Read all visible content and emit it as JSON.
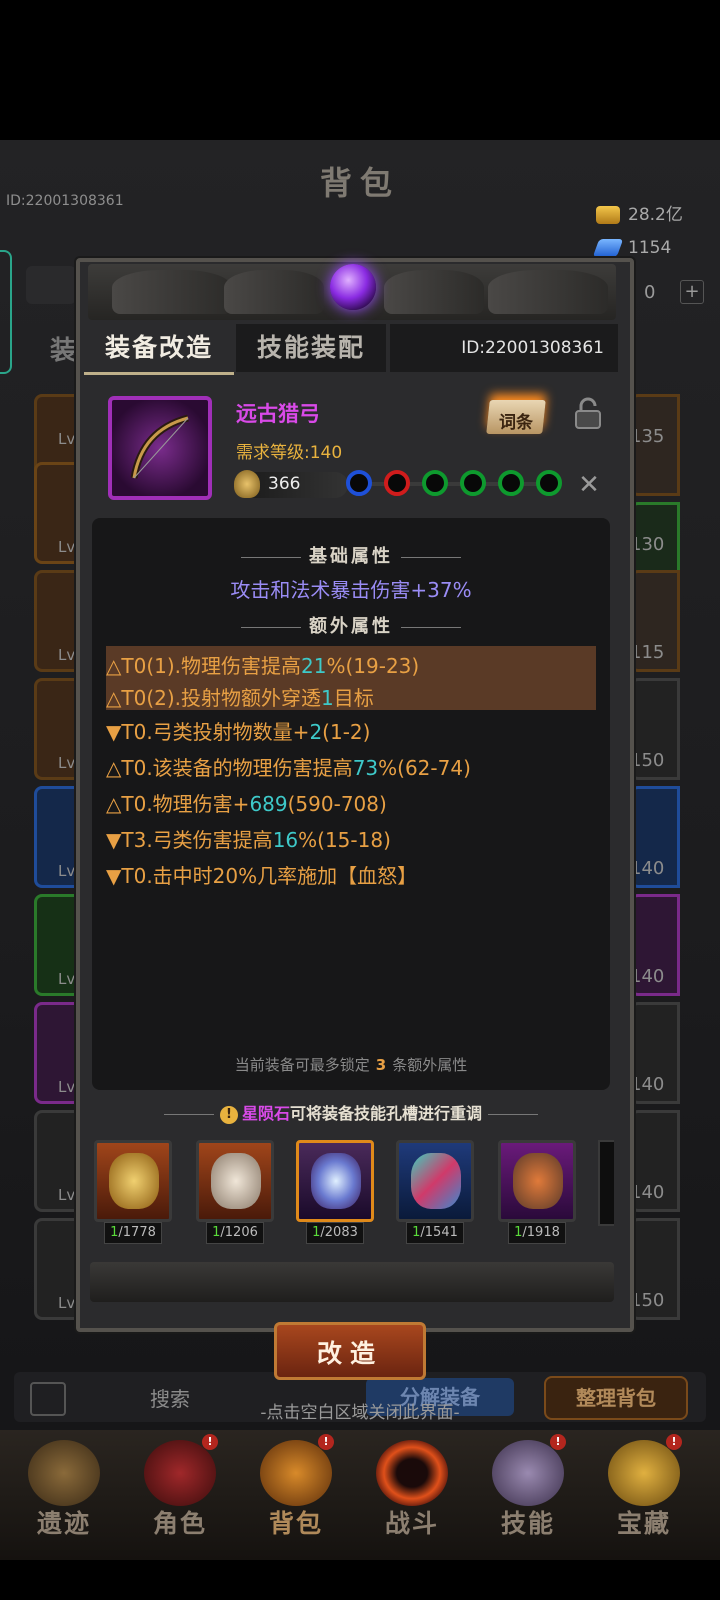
{
  "background": {
    "bag_title": "背包",
    "player_id": "ID:22001308361",
    "gold": "28.2亿",
    "gems": "1154",
    "third_resource": "0",
    "plus_label": "+",
    "left_tab_fragment": "装",
    "slot_lv_label": "Lv",
    "slot_levels": [
      "135",
      "130",
      "115",
      "150",
      "140",
      "140",
      "140",
      "140",
      "150"
    ],
    "search_label": "搜索",
    "decompose_label": "分解装备",
    "sort_label": "整理背包",
    "close_hint": "-点击空白区域关闭此界面-"
  },
  "nav": {
    "items": [
      {
        "label": "遗迹",
        "badge": ""
      },
      {
        "label": "角色",
        "badge": "!"
      },
      {
        "label": "背包",
        "badge": "!"
      },
      {
        "label": "战斗",
        "badge": ""
      },
      {
        "label": "技能",
        "badge": "!"
      },
      {
        "label": "宝藏",
        "badge": "!"
      }
    ]
  },
  "modal": {
    "tabs": {
      "reforge": "装备改造",
      "skill": "技能装配"
    },
    "id": "ID:22001308361",
    "item": {
      "name": "远古猎弓",
      "requirement": "需求等级:140",
      "power": "366",
      "affix_button": "词条"
    },
    "sockets": [
      "blue",
      "red",
      "green",
      "green",
      "green",
      "green"
    ],
    "colors": {
      "blue": "#1e50d8",
      "red": "#d01c1c",
      "green": "#0e9a2e",
      "accent": "#d94ae8",
      "affix": "#e8a044",
      "value": "#3ec9c9"
    },
    "base_title": "基础属性",
    "base_attr": "攻击和法术暴击伤害+37%",
    "extra_title": "额外属性",
    "affixes": [
      {
        "pre": "△T0(1).物理伤害提高",
        "val": "21",
        "post": "%(19-23)",
        "highlight": true
      },
      {
        "pre": "△T0(2).投射物额外穿透",
        "val": "1",
        "post": "目标",
        "highlight": true
      },
      {
        "pre": "▼T0.弓类投射物数量+",
        "val": "2",
        "post": "(1-2)",
        "highlight": false
      },
      {
        "pre": "△T0.该装备的物理伤害提高",
        "val": "73",
        "post": "%(62-74)",
        "highlight": false
      },
      {
        "pre": "△T0.物理伤害+",
        "val": "689",
        "post": "(590-708)",
        "highlight": false
      },
      {
        "pre": "▼T3.弓类伤害提高",
        "val": "16",
        "post": "%(15-18)",
        "highlight": false
      },
      {
        "pre": "▼T0.击中时20%几率施加【血怒】",
        "val": "",
        "post": "",
        "highlight": false
      }
    ],
    "lock_note": {
      "pre": "当前装备可最多锁定",
      "num": "3",
      "post": "条额外属性"
    },
    "stone_hint": {
      "stone": "星陨石",
      "rest": "可将装备技能孔槽进行重调"
    },
    "materials": [
      {
        "name": "golden-orb",
        "have": "1",
        "need": "/1778"
      },
      {
        "name": "twin-masks",
        "have": "1",
        "need": "/1206"
      },
      {
        "name": "star-crystal",
        "have": "1",
        "need": "/2083"
      },
      {
        "name": "prism-ore",
        "have": "1",
        "need": "/1541"
      },
      {
        "name": "ember-ore",
        "have": "1",
        "need": "/1918"
      }
    ],
    "reforge_button": "改造"
  }
}
